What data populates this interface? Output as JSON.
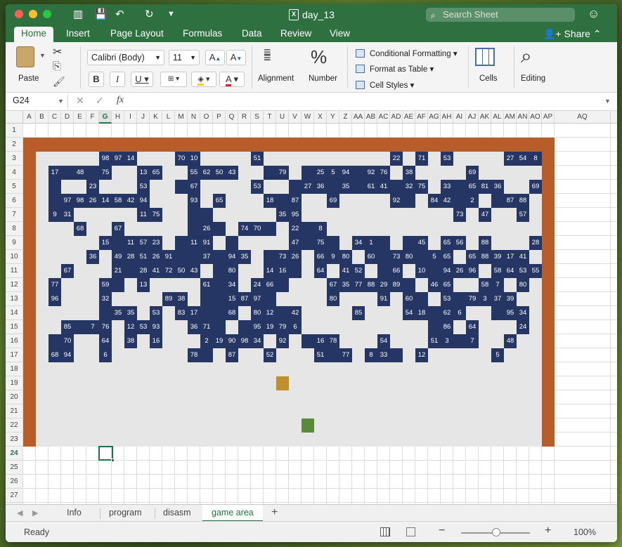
{
  "window": {
    "title": "day_13",
    "search_placeholder": "Search Sheet"
  },
  "ribbon_tabs": [
    "Home",
    "Insert",
    "Page Layout",
    "Formulas",
    "Data",
    "Review",
    "View"
  ],
  "share_label": "Share",
  "ribbon": {
    "paste": "Paste",
    "font_name": "Calibri (Body)",
    "font_size": "11",
    "alignment": "Alignment",
    "number": "Number",
    "conditional_formatting": "Conditional Formatting",
    "format_as_table": "Format as Table",
    "cell_styles": "Cell Styles",
    "cells": "Cells",
    "editing": "Editing"
  },
  "formula_bar": {
    "cell_ref": "G24",
    "formula": ""
  },
  "columns": [
    "A",
    "B",
    "C",
    "D",
    "E",
    "F",
    "G",
    "H",
    "I",
    "J",
    "K",
    "L",
    "M",
    "N",
    "O",
    "P",
    "Q",
    "R",
    "S",
    "T",
    "U",
    "V",
    "W",
    "X",
    "Y",
    "Z",
    "AA",
    "AB",
    "AC",
    "AD",
    "AE",
    "AF",
    "AG",
    "AH",
    "AI",
    "AJ",
    "AK",
    "AL",
    "AM",
    "AN",
    "AO",
    "AP",
    "AQ"
  ],
  "rows": [
    "1",
    "2",
    "3",
    "4",
    "5",
    "6",
    "7",
    "8",
    "9",
    "10",
    "11",
    "12",
    "13",
    "14",
    "15",
    "16",
    "17",
    "18",
    "19",
    "20",
    "21",
    "22",
    "23",
    "24",
    "25",
    "26",
    "27",
    "28"
  ],
  "selected_cell": "G24",
  "game": {
    "blocks": [
      [
        3,
        6,
        "98"
      ],
      [
        3,
        7,
        "97"
      ],
      [
        3,
        8,
        "14"
      ],
      [
        3,
        12,
        "70"
      ],
      [
        3,
        13,
        "10"
      ],
      [
        3,
        18,
        "51"
      ],
      [
        3,
        29,
        "22"
      ],
      [
        3,
        31,
        "71"
      ],
      [
        3,
        33,
        "53"
      ],
      [
        3,
        38,
        "27"
      ],
      [
        3,
        39,
        "54"
      ],
      [
        3,
        40,
        "8"
      ],
      [
        4,
        2,
        "17"
      ],
      [
        4,
        4,
        "48"
      ],
      [
        4,
        6,
        "75"
      ],
      [
        4,
        9,
        "13"
      ],
      [
        4,
        10,
        "65"
      ],
      [
        4,
        13,
        "55"
      ],
      [
        4,
        14,
        "62"
      ],
      [
        4,
        15,
        "50"
      ],
      [
        4,
        16,
        "43"
      ],
      [
        4,
        20,
        "79"
      ],
      [
        4,
        23,
        "25"
      ],
      [
        4,
        24,
        "5"
      ],
      [
        4,
        25,
        "94"
      ],
      [
        4,
        27,
        "92"
      ],
      [
        4,
        28,
        "76"
      ],
      [
        4,
        30,
        "38"
      ],
      [
        4,
        35,
        "69"
      ],
      [
        5,
        5,
        "23"
      ],
      [
        5,
        9,
        "53"
      ],
      [
        5,
        13,
        "67"
      ],
      [
        5,
        18,
        "53"
      ],
      [
        5,
        22,
        "27"
      ],
      [
        5,
        23,
        "36"
      ],
      [
        5,
        25,
        "35"
      ],
      [
        5,
        27,
        "61"
      ],
      [
        5,
        28,
        "41"
      ],
      [
        5,
        30,
        "32"
      ],
      [
        5,
        31,
        "75"
      ],
      [
        5,
        33,
        "33"
      ],
      [
        5,
        35,
        "65"
      ],
      [
        5,
        36,
        "81"
      ],
      [
        5,
        37,
        "36"
      ],
      [
        5,
        40,
        "69"
      ],
      [
        6,
        3,
        "97"
      ],
      [
        6,
        4,
        "98"
      ],
      [
        6,
        5,
        "26"
      ],
      [
        6,
        6,
        "14"
      ],
      [
        6,
        7,
        "58"
      ],
      [
        6,
        8,
        "42"
      ],
      [
        6,
        9,
        "94"
      ],
      [
        6,
        13,
        "93"
      ],
      [
        6,
        15,
        "65"
      ],
      [
        6,
        19,
        "18"
      ],
      [
        6,
        21,
        "87"
      ],
      [
        6,
        24,
        "69"
      ],
      [
        6,
        29,
        "92"
      ],
      [
        6,
        32,
        "84"
      ],
      [
        6,
        33,
        "42"
      ],
      [
        6,
        35,
        "2"
      ],
      [
        6,
        38,
        "87"
      ],
      [
        6,
        39,
        "88"
      ],
      [
        7,
        2,
        "9"
      ],
      [
        7,
        3,
        "31"
      ],
      [
        7,
        9,
        "11"
      ],
      [
        7,
        10,
        "75"
      ],
      [
        7,
        20,
        "35"
      ],
      [
        7,
        21,
        "95"
      ],
      [
        7,
        34,
        "73"
      ],
      [
        7,
        36,
        "47"
      ],
      [
        7,
        39,
        "57"
      ],
      [
        8,
        4,
        "68"
      ],
      [
        8,
        7,
        "67"
      ],
      [
        8,
        14,
        "26"
      ],
      [
        8,
        17,
        "74"
      ],
      [
        8,
        18,
        "70"
      ],
      [
        8,
        21,
        "22"
      ],
      [
        8,
        23,
        "8"
      ],
      [
        9,
        6,
        "15"
      ],
      [
        9,
        8,
        "11"
      ],
      [
        9,
        9,
        "57"
      ],
      [
        9,
        10,
        "23"
      ],
      [
        9,
        13,
        "11"
      ],
      [
        9,
        14,
        "91"
      ],
      [
        9,
        21,
        "47"
      ],
      [
        9,
        23,
        "75"
      ],
      [
        9,
        26,
        "34"
      ],
      [
        9,
        27,
        "1"
      ],
      [
        9,
        31,
        "45"
      ],
      [
        9,
        33,
        "65"
      ],
      [
        9,
        34,
        "56"
      ],
      [
        9,
        36,
        "88"
      ],
      [
        9,
        40,
        "28"
      ],
      [
        10,
        5,
        "36"
      ],
      [
        10,
        7,
        "49"
      ],
      [
        10,
        8,
        "28"
      ],
      [
        10,
        9,
        "51"
      ],
      [
        10,
        10,
        "26"
      ],
      [
        10,
        11,
        "91"
      ],
      [
        10,
        14,
        "37"
      ],
      [
        10,
        16,
        "94"
      ],
      [
        10,
        17,
        "35"
      ],
      [
        10,
        20,
        "73"
      ],
      [
        10,
        21,
        "26"
      ],
      [
        10,
        23,
        "66"
      ],
      [
        10,
        24,
        "9"
      ],
      [
        10,
        25,
        "80"
      ],
      [
        10,
        27,
        "60"
      ],
      [
        10,
        29,
        "73"
      ],
      [
        10,
        30,
        "80"
      ],
      [
        10,
        32,
        "5"
      ],
      [
        10,
        33,
        "65"
      ],
      [
        10,
        35,
        "65"
      ],
      [
        10,
        36,
        "88"
      ],
      [
        10,
        37,
        "39"
      ],
      [
        10,
        38,
        "17"
      ],
      [
        10,
        39,
        "41"
      ],
      [
        11,
        3,
        "67"
      ],
      [
        11,
        7,
        "21"
      ],
      [
        11,
        9,
        "28"
      ],
      [
        11,
        10,
        "41"
      ],
      [
        11,
        11,
        "72"
      ],
      [
        11,
        12,
        "50"
      ],
      [
        11,
        13,
        "43"
      ],
      [
        11,
        16,
        "80"
      ],
      [
        11,
        19,
        "14"
      ],
      [
        11,
        20,
        "16"
      ],
      [
        11,
        23,
        "64"
      ],
      [
        11,
        25,
        "41"
      ],
      [
        11,
        26,
        "52"
      ],
      [
        11,
        29,
        "66"
      ],
      [
        11,
        31,
        "10"
      ],
      [
        11,
        33,
        "94"
      ],
      [
        11,
        34,
        "26"
      ],
      [
        11,
        35,
        "96"
      ],
      [
        11,
        37,
        "58"
      ],
      [
        11,
        38,
        "64"
      ],
      [
        11,
        39,
        "53"
      ],
      [
        11,
        40,
        "55"
      ],
      [
        12,
        2,
        "77"
      ],
      [
        12,
        6,
        "59"
      ],
      [
        12,
        9,
        "13"
      ],
      [
        12,
        14,
        "61"
      ],
      [
        12,
        16,
        "34"
      ],
      [
        12,
        18,
        "24"
      ],
      [
        12,
        19,
        "66"
      ],
      [
        12,
        24,
        "67"
      ],
      [
        12,
        25,
        "35"
      ],
      [
        12,
        26,
        "77"
      ],
      [
        12,
        27,
        "88"
      ],
      [
        12,
        28,
        "29"
      ],
      [
        12,
        29,
        "89"
      ],
      [
        12,
        32,
        "46"
      ],
      [
        12,
        33,
        "65"
      ],
      [
        12,
        36,
        "58"
      ],
      [
        12,
        37,
        "7"
      ],
      [
        12,
        39,
        "80"
      ],
      [
        13,
        2,
        "96"
      ],
      [
        13,
        6,
        "32"
      ],
      [
        13,
        11,
        "89"
      ],
      [
        13,
        12,
        "38"
      ],
      [
        13,
        16,
        "15"
      ],
      [
        13,
        17,
        "87"
      ],
      [
        13,
        18,
        "97"
      ],
      [
        13,
        24,
        "80"
      ],
      [
        13,
        28,
        "91"
      ],
      [
        13,
        30,
        "60"
      ],
      [
        13,
        33,
        "53"
      ],
      [
        13,
        35,
        "79"
      ],
      [
        13,
        36,
        "3"
      ],
      [
        13,
        37,
        "37"
      ],
      [
        13,
        38,
        "39"
      ],
      [
        14,
        7,
        "35"
      ],
      [
        14,
        8,
        "35"
      ],
      [
        14,
        10,
        "53"
      ],
      [
        14,
        12,
        "83"
      ],
      [
        14,
        13,
        "17"
      ],
      [
        14,
        16,
        "68"
      ],
      [
        14,
        18,
        "80"
      ],
      [
        14,
        19,
        "12"
      ],
      [
        14,
        21,
        "42"
      ],
      [
        14,
        26,
        "85"
      ],
      [
        14,
        30,
        "54"
      ],
      [
        14,
        31,
        "18"
      ],
      [
        14,
        33,
        "62"
      ],
      [
        14,
        34,
        "6"
      ],
      [
        14,
        38,
        "95"
      ],
      [
        14,
        39,
        "34"
      ],
      [
        15,
        3,
        "85"
      ],
      [
        15,
        5,
        "7"
      ],
      [
        15,
        6,
        "76"
      ],
      [
        15,
        8,
        "12"
      ],
      [
        15,
        9,
        "53"
      ],
      [
        15,
        10,
        "93"
      ],
      [
        15,
        13,
        "36"
      ],
      [
        15,
        14,
        "71"
      ],
      [
        15,
        18,
        "95"
      ],
      [
        15,
        19,
        "19"
      ],
      [
        15,
        20,
        "79"
      ],
      [
        15,
        21,
        "6"
      ],
      [
        15,
        33,
        "86"
      ],
      [
        15,
        35,
        "64"
      ],
      [
        15,
        39,
        "24"
      ],
      [
        16,
        3,
        "70"
      ],
      [
        16,
        6,
        "64"
      ],
      [
        16,
        8,
        "38"
      ],
      [
        16,
        10,
        "16"
      ],
      [
        16,
        14,
        "2"
      ],
      [
        16,
        15,
        "19"
      ],
      [
        16,
        16,
        "90"
      ],
      [
        16,
        17,
        "98"
      ],
      [
        16,
        18,
        "34"
      ],
      [
        16,
        20,
        "92"
      ],
      [
        16,
        23,
        "16"
      ],
      [
        16,
        24,
        "78"
      ],
      [
        16,
        28,
        "54"
      ],
      [
        16,
        32,
        "51"
      ],
      [
        16,
        33,
        "3"
      ],
      [
        16,
        35,
        "7"
      ],
      [
        16,
        38,
        "48"
      ],
      [
        17,
        2,
        "68"
      ],
      [
        17,
        3,
        "94"
      ],
      [
        17,
        6,
        "6"
      ],
      [
        17,
        13,
        "78"
      ],
      [
        17,
        16,
        "87"
      ],
      [
        17,
        19,
        "52"
      ],
      [
        17,
        23,
        "51"
      ],
      [
        17,
        25,
        "77"
      ],
      [
        17,
        27,
        "8"
      ],
      [
        17,
        28,
        "33"
      ],
      [
        17,
        31,
        "12"
      ],
      [
        17,
        37,
        "5"
      ]
    ],
    "extra_blocks": [
      [
        4,
        3
      ],
      [
        4,
        5
      ],
      [
        4,
        14
      ],
      [
        4,
        19
      ],
      [
        4,
        22
      ],
      [
        4,
        24
      ],
      [
        4,
        26
      ],
      [
        5,
        2
      ],
      [
        5,
        12
      ],
      [
        5,
        21
      ],
      [
        5,
        24
      ],
      [
        5,
        26
      ],
      [
        5,
        29
      ],
      [
        5,
        34
      ],
      [
        6,
        2
      ],
      [
        6,
        20
      ],
      [
        6,
        30
      ],
      [
        6,
        34
      ],
      [
        6,
        37
      ],
      [
        7,
        13
      ],
      [
        7,
        14
      ],
      [
        8,
        13
      ],
      [
        8,
        15
      ],
      [
        8,
        19
      ],
      [
        8,
        22
      ],
      [
        9,
        7
      ],
      [
        9,
        12
      ],
      [
        9,
        16
      ],
      [
        9,
        22
      ],
      [
        9,
        24
      ],
      [
        9,
        28
      ],
      [
        9,
        30
      ],
      [
        10,
        12
      ],
      [
        10,
        13
      ],
      [
        10,
        15
      ],
      [
        10,
        19
      ],
      [
        10,
        28
      ],
      [
        10,
        31
      ],
      [
        11,
        8
      ],
      [
        11,
        15
      ],
      [
        11,
        21
      ],
      [
        11,
        28
      ],
      [
        11,
        32
      ],
      [
        12,
        7
      ],
      [
        12,
        15
      ],
      [
        12,
        20
      ],
      [
        12,
        30
      ],
      [
        13,
        14
      ],
      [
        13,
        15
      ],
      [
        13,
        19
      ],
      [
        13,
        31
      ],
      [
        13,
        34
      ],
      [
        14,
        6
      ],
      [
        14,
        14
      ],
      [
        14,
        15
      ],
      [
        14,
        20
      ],
      [
        14,
        32
      ],
      [
        14,
        37
      ],
      [
        15,
        4
      ],
      [
        15,
        15
      ],
      [
        15,
        17
      ],
      [
        15,
        32
      ],
      [
        16,
        2
      ],
      [
        16,
        15
      ],
      [
        16,
        22
      ],
      [
        16,
        34
      ],
      [
        17,
        14
      ],
      [
        17,
        24
      ],
      [
        17,
        29
      ]
    ],
    "ball": [
      19,
      20
    ],
    "paddle": [
      22,
      22
    ]
  },
  "sheet_tabs": [
    "Info",
    "program",
    "disasm",
    "game area"
  ],
  "active_sheet": "game area",
  "status": {
    "text": "Ready",
    "zoom": "100%"
  },
  "colors": {
    "accent": "#217346",
    "titlebar": "#2e7040",
    "block": "#253665",
    "frame": "#b85c2a",
    "ball": "#c0902c",
    "paddle": "#5a8a3c",
    "field": "#e6e6e6"
  }
}
